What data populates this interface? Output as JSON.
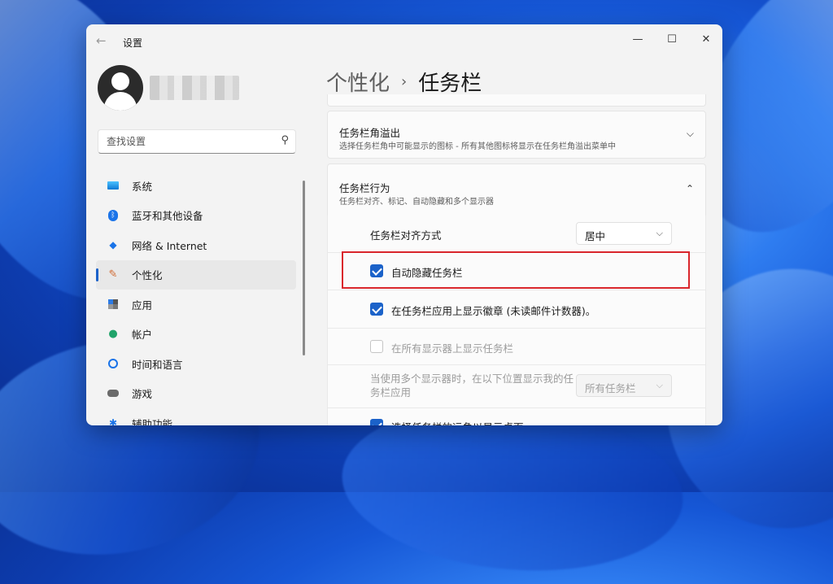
{
  "window": {
    "title": "设置"
  },
  "controls": {
    "minimize": "—",
    "maximize": "☐",
    "close": "✕"
  },
  "search": {
    "placeholder": "查找设置"
  },
  "sidebar": {
    "items": [
      {
        "label": "系统",
        "icon": "monitor-icon"
      },
      {
        "label": "蓝牙和其他设备",
        "icon": "bluetooth-icon"
      },
      {
        "label": "网络 & Internet",
        "icon": "wifi-icon"
      },
      {
        "label": "个性化",
        "icon": "brush-icon",
        "active": true
      },
      {
        "label": "应用",
        "icon": "apps-icon"
      },
      {
        "label": "帐户",
        "icon": "person-icon"
      },
      {
        "label": "时间和语言",
        "icon": "globe-clock-icon"
      },
      {
        "label": "游戏",
        "icon": "gamepad-icon"
      },
      {
        "label": "辅助功能",
        "icon": "accessibility-icon"
      }
    ]
  },
  "breadcrumb": {
    "parent": "个性化",
    "separator": "›",
    "current": "任务栏"
  },
  "overflow_card": {
    "title": "任务栏角溢出",
    "subtitle": "选择任务栏角中可能显示的图标 - 所有其他图标将显示在任务栏角溢出菜单中"
  },
  "behaviors_card": {
    "title": "任务栏行为",
    "subtitle": "任务栏对齐、标记、自动隐藏和多个显示器"
  },
  "settings": {
    "alignment_label": "任务栏对齐方式",
    "alignment_value": "居中",
    "auto_hide": {
      "label": "自动隐藏任务栏",
      "checked": true
    },
    "badges": {
      "label": "在任务栏应用上显示徽章 (未读邮件计数器)。",
      "checked": true
    },
    "all_displays": {
      "label": "在所有显示器上显示任务栏",
      "checked": false,
      "disabled": true
    },
    "multi_display_label": "当使用多个显示器时，在以下位置显示我的任务栏应用",
    "multi_display_value": "所有任务栏",
    "peek": {
      "label": "选择任务栏的远角以显示桌面",
      "checked": true
    }
  },
  "colors": {
    "accent": "#1b62c9",
    "highlight_border": "#d9262c"
  }
}
